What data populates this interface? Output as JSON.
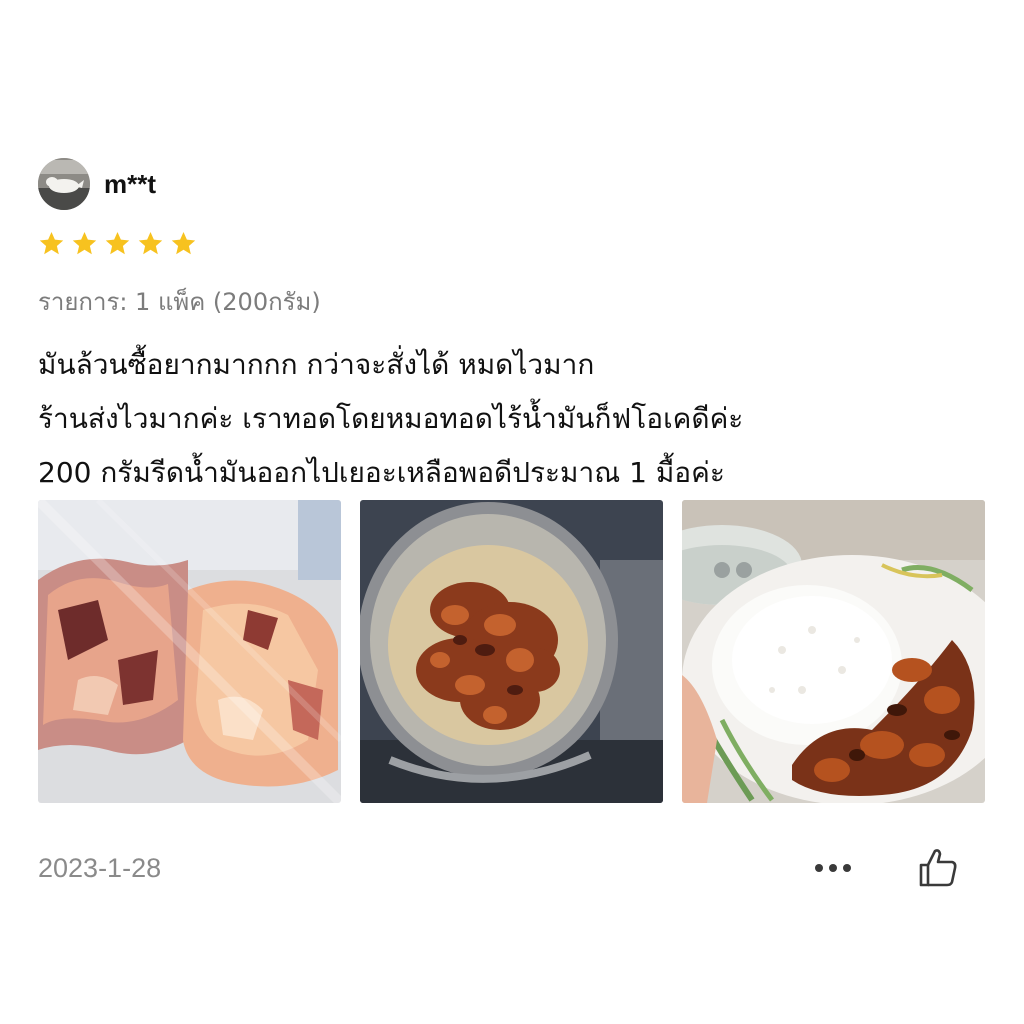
{
  "review": {
    "username": "m**t",
    "rating": 5,
    "max_rating": 5,
    "variant": "รายการ: 1 แพ็ค (200กรัม)",
    "text_lines": [
      "มันล้วนซื้อยากมากกก กว่าจะสั่งได้ หมดไวมาก",
      "ร้านส่งไวมากค่ะ เราทอดโดยหมอทอดไร้น้ำมันก็ฟโอเคดีค่ะ",
      "200 กรัมรีดน้ำมันออกไปเยอะเหลือพอดีประมาณ 1 มื้อค่ะ"
    ],
    "photos": [
      {
        "subject": "raw pork belly in vacuum pack"
      },
      {
        "subject": "fried crispy pork in mesh strainer"
      },
      {
        "subject": "crispy pork with steamed rice on plate"
      }
    ],
    "date": "2023-1-28"
  },
  "icons": {
    "star": "star-icon",
    "more": "more-dots-icon",
    "like": "thumbs-up-icon"
  },
  "colors": {
    "star": "#F7C21F",
    "text": "#111111",
    "muted": "#7C7C7C",
    "date": "#8A8A8A"
  }
}
